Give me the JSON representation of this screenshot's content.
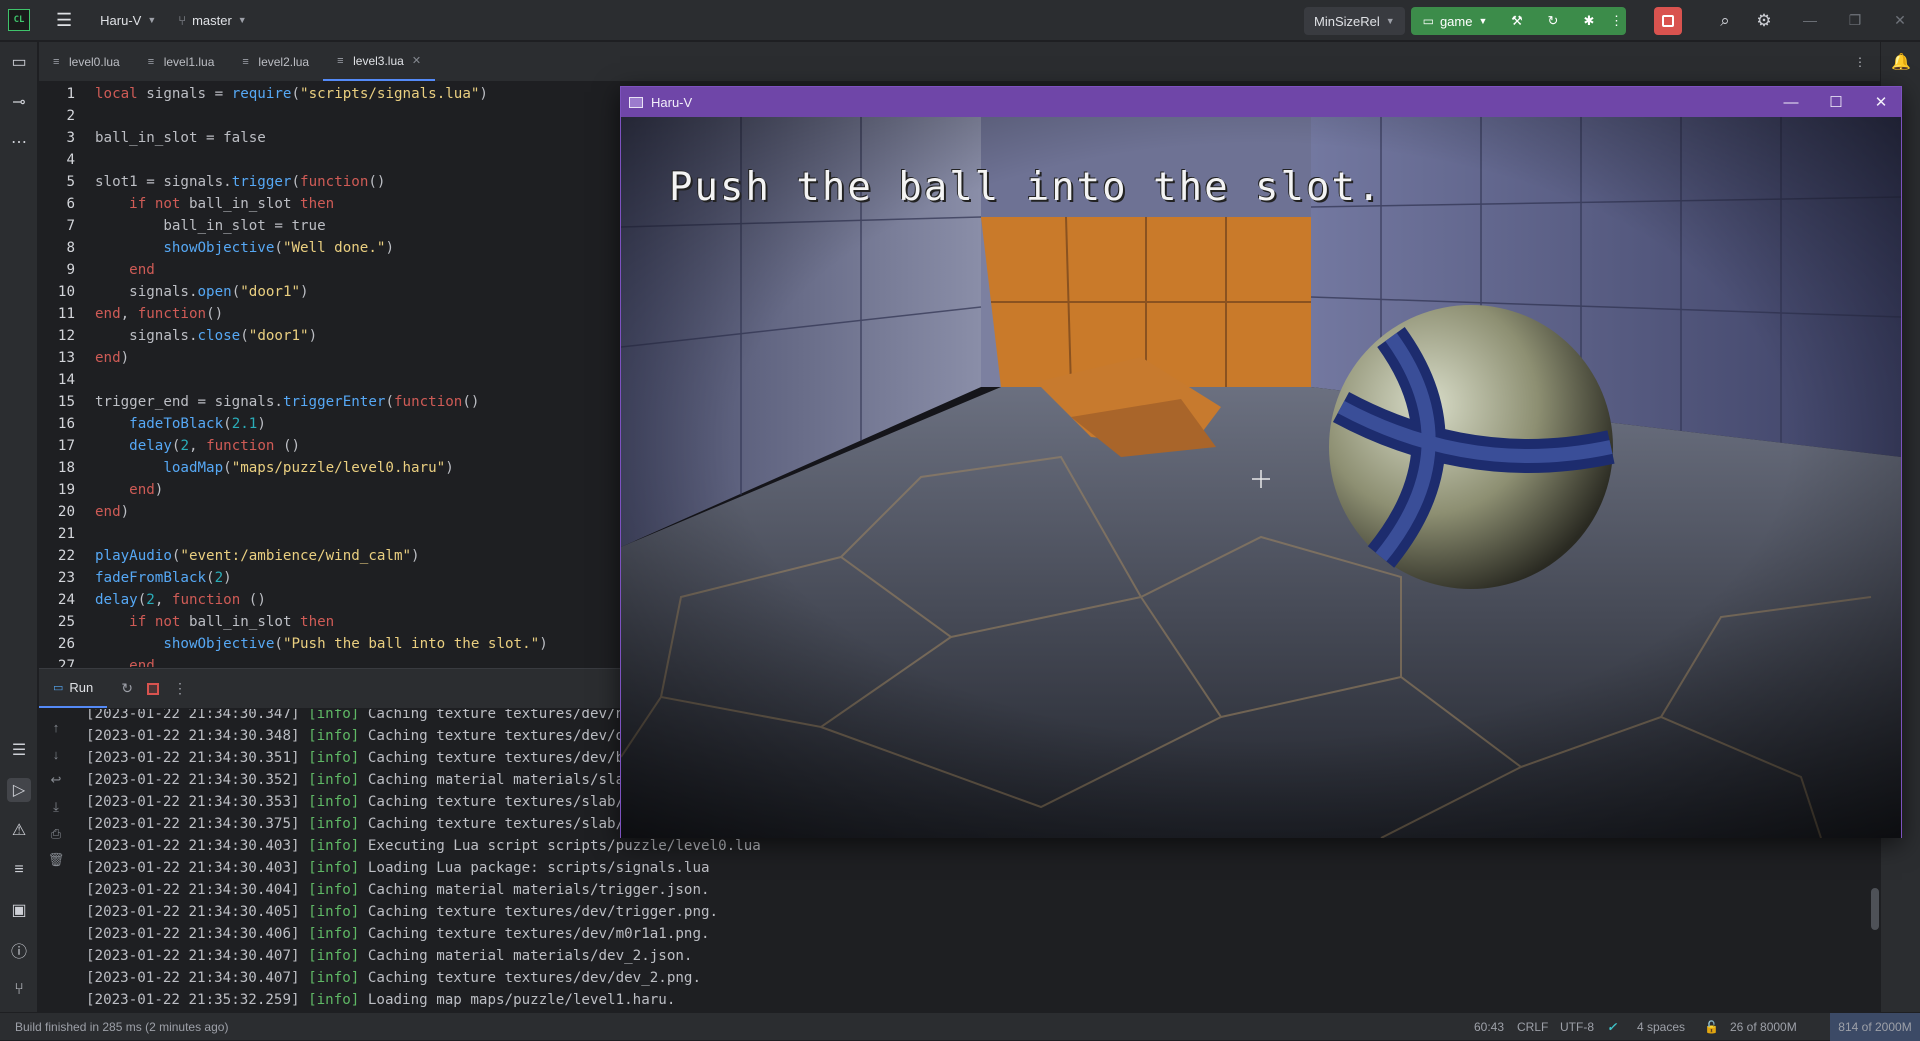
{
  "titlebar": {
    "logo": "CL",
    "project": "Haru-V",
    "branch": "master",
    "build_config": "MinSizeRel",
    "run_target": "game",
    "icons": [
      "hamburger-menu-icon",
      "branch-icon",
      "build-hammer-icon",
      "rerun-icon",
      "debug-bug-icon",
      "more-vertical-icon",
      "stop-icon",
      "search-icon",
      "gear-icon"
    ]
  },
  "tabs": [
    {
      "label": "level0.lua",
      "active": false
    },
    {
      "label": "level1.lua",
      "active": false
    },
    {
      "label": "level2.lua",
      "active": false
    },
    {
      "label": "level3.lua",
      "active": true
    }
  ],
  "editor": {
    "line_numbers": [
      "1",
      "2",
      "3",
      "4",
      "5",
      "6",
      "7",
      "8",
      "9",
      "10",
      "11",
      "12",
      "13",
      "14",
      "15",
      "16",
      "17",
      "18",
      "19",
      "20",
      "21",
      "22",
      "23",
      "24",
      "25",
      "26",
      "27"
    ],
    "lines": [
      "local signals = require(\"scripts/signals.lua\")",
      "",
      "ball_in_slot = false",
      "",
      "slot1 = signals.trigger(function()",
      "    if not ball_in_slot then",
      "        ball_in_slot = true",
      "        showObjective(\"Well done.\")",
      "    end",
      "    signals.open(\"door1\")",
      "end, function()",
      "    signals.close(\"door1\")",
      "end)",
      "",
      "trigger_end = signals.triggerEnter(function()",
      "    fadeToBlack(2.1)",
      "    delay(2, function ()",
      "        loadMap(\"maps/puzzle/level0.haru\")",
      "    end)",
      "end)",
      "",
      "playAudio(\"event:/ambience/wind_calm\")",
      "fadeFromBlack(2)",
      "delay(2, function ()",
      "    if not ball_in_slot then",
      "        showObjective(\"Push the ball into the slot.\")",
      "    end"
    ]
  },
  "run_panel": {
    "tab_label": "Run",
    "logs": [
      {
        "ts": "[2023-01-22 21:34:30.347]",
        "level": "[info]",
        "msg": "Caching texture textures/dev/norma"
      },
      {
        "ts": "[2023-01-22 21:34:30.348]",
        "level": "[info]",
        "msg": "Caching texture textures/dev/dev_m"
      },
      {
        "ts": "[2023-01-22 21:34:30.351]",
        "level": "[info]",
        "msg": "Caching texture textures/dev/black"
      },
      {
        "ts": "[2023-01-22 21:34:30.352]",
        "level": "[info]",
        "msg": "Caching material materials/slab.js"
      },
      {
        "ts": "[2023-01-22 21:34:30.353]",
        "level": "[info]",
        "msg": "Caching texture textures/slab/albe"
      },
      {
        "ts": "[2023-01-22 21:34:30.375]",
        "level": "[info]",
        "msg": "Caching texture textures/slab/mra."
      },
      {
        "ts": "[2023-01-22 21:34:30.403]",
        "level": "[info]",
        "msg": "Executing Lua script scripts/puzzle/level0.lua"
      },
      {
        "ts": "[2023-01-22 21:34:30.403]",
        "level": "[info]",
        "msg": "Loading Lua package: scripts/signals.lua"
      },
      {
        "ts": "[2023-01-22 21:34:30.404]",
        "level": "[info]",
        "msg": "Caching material materials/trigger.json."
      },
      {
        "ts": "[2023-01-22 21:34:30.405]",
        "level": "[info]",
        "msg": "Caching texture textures/dev/trigger.png."
      },
      {
        "ts": "[2023-01-22 21:34:30.406]",
        "level": "[info]",
        "msg": "Caching texture textures/dev/m0r1a1.png."
      },
      {
        "ts": "[2023-01-22 21:34:30.407]",
        "level": "[info]",
        "msg": "Caching material materials/dev_2.json."
      },
      {
        "ts": "[2023-01-22 21:34:30.407]",
        "level": "[info]",
        "msg": "Caching texture textures/dev/dev_2.png."
      },
      {
        "ts": "[2023-01-22 21:35:32.259]",
        "level": "[info]",
        "msg": "Loading map maps/puzzle/level1.haru."
      }
    ]
  },
  "game_window": {
    "title": "Haru-V",
    "objective": "Push the ball into the slot.",
    "colors": {
      "titlebar": "#6f46a8",
      "wall": "#5a5e7e",
      "door": "#c97a2a",
      "floor": "#3b4150"
    }
  },
  "statusbar": {
    "build": "Build finished in 285 ms (2 minutes ago)",
    "position": "60:43",
    "line_sep": "CRLF",
    "encoding": "UTF-8",
    "indent": "4 spaces",
    "lines_info": "26 of 8000M",
    "memory": "814 of 2000M"
  }
}
